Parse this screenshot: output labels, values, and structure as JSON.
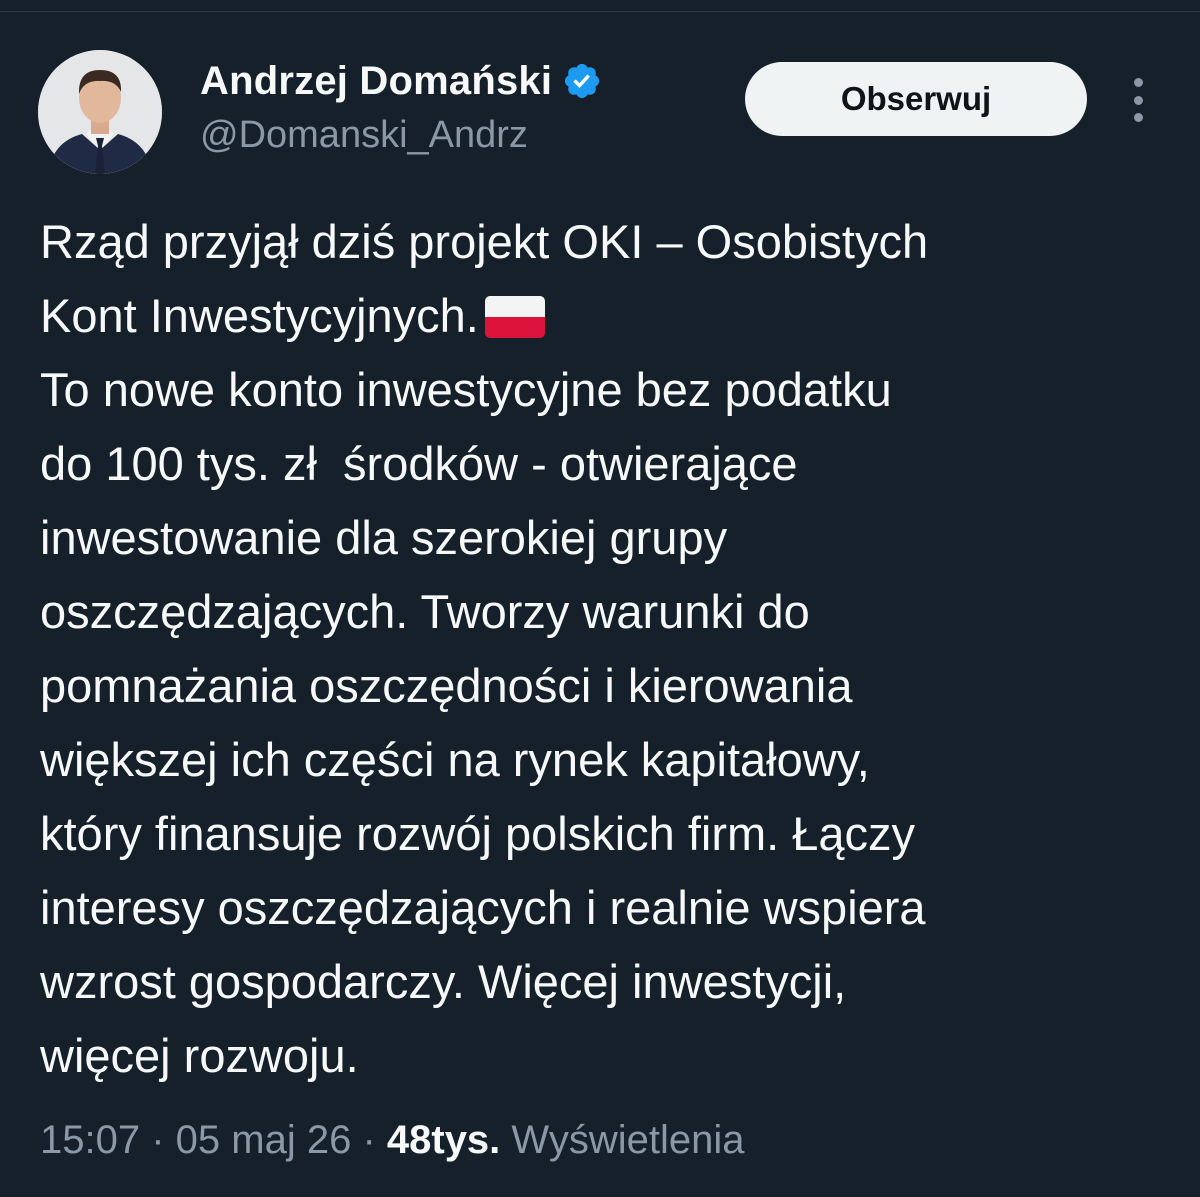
{
  "author": {
    "display_name": "Andrzej Domański",
    "handle": "@Domanski_Andrz",
    "verified": true,
    "verified_color": "#1d9bf0"
  },
  "actions": {
    "follow_label": "Obserwuj",
    "more_icon": "more-vertical-icon"
  },
  "tweet": {
    "lines": [
      "Rząd przyjął dziś projekt OKI – Osobistych",
      "Kont Inwestycyjnych.",
      "To nowe konto inwestycyjne bez podatku",
      "do 100 tys. zł  środków - otwierające",
      "inwestowanie dla szerokiej grupy",
      "oszczędzających. Tworzy warunki do",
      "pomnażania oszczędności i kierowania",
      "większej ich części na rynek kapitałowy,",
      "który finansuje rozwój polskich firm. Łączy",
      "interesy oszczędzających i realnie wspiera",
      "wzrost gospodarczy. Więcej inwestycji,",
      "więcej rozwoju."
    ],
    "emoji": "flag-poland-icon"
  },
  "meta": {
    "time": "15:07",
    "separator": " · ",
    "date": "05 maj 26",
    "views_count": "48tys.",
    "views_label": "Wyświetlenia"
  },
  "colors": {
    "background": "#15202b",
    "text": "#f7f9f9",
    "secondary_text": "#8b98a5",
    "button_bg": "#eff3f4"
  }
}
